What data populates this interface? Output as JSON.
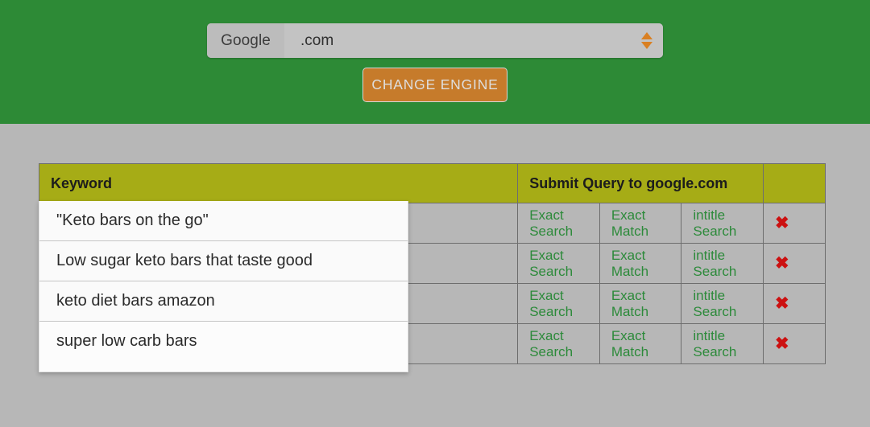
{
  "engine_bar": {
    "background_color": "#2d8a36",
    "select": {
      "prefix_label": "Google",
      "value": ".com",
      "spinner_icon": "spinner-updown-icon",
      "spinner_color": "#d98023"
    },
    "change_engine_button": {
      "label": "CHANGE ENGINE",
      "background_color": "#c67b2b",
      "text_color": "#dedede"
    }
  },
  "table": {
    "header_background_color": "#a6ac16",
    "link_color": "#2c8a3a",
    "columns": [
      {
        "key": "keyword",
        "label": "Keyword"
      },
      {
        "key": "submit_query",
        "label": "Submit Query to google.com"
      },
      {
        "key": "delete",
        "label": ""
      }
    ],
    "action_labels": {
      "exact_search": "Exact Search",
      "exact_match": "Exact Match",
      "intitle_search": "intitle Search",
      "delete_icon": "delete-x-icon",
      "delete_glyph": "✖"
    },
    "rows": [
      {
        "keyword": "\"Keto bars on the go\"",
        "exact_search": "Exact Search",
        "exact_match": "Exact Match",
        "intitle_search": "intitle Search"
      },
      {
        "keyword": "Low sugar keto bars that taste good",
        "exact_search": "Exact Search",
        "exact_match": "Exact Match",
        "intitle_search": "intitle Search"
      },
      {
        "keyword": "keto diet bars amazon",
        "exact_search": "Exact Search",
        "exact_match": "Exact Match",
        "intitle_search": "intitle Search"
      },
      {
        "keyword": "super low carb bars",
        "exact_search": "Exact Search",
        "exact_match": "Exact Match",
        "intitle_search": "intitle Search"
      }
    ]
  },
  "keyword_overlay": {
    "background_color": "#fafafa",
    "items": [
      {
        "text": "\"Keto bars on the go\""
      },
      {
        "text": "Low sugar keto bars that taste good"
      },
      {
        "text": "keto diet bars amazon"
      },
      {
        "text": "super low carb bars"
      }
    ]
  }
}
